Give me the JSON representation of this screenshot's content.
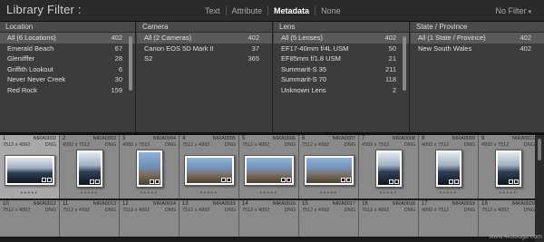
{
  "filter_bar": {
    "title": "Library Filter :",
    "modes": [
      "Text",
      "Attribute",
      "Metadata",
      "None"
    ],
    "active_mode": "Metadata",
    "preset": "No Filter"
  },
  "columns": [
    {
      "header": "Location",
      "rows": [
        {
          "label": "All (6 Locations)",
          "count": "402",
          "selected": true
        },
        {
          "label": "Emerald Beach",
          "count": "67"
        },
        {
          "label": "Glenifffer",
          "count": "28"
        },
        {
          "label": "Griffith Lookout",
          "count": "6"
        },
        {
          "label": "Never Never Creek",
          "count": "30"
        },
        {
          "label": "Red Rock",
          "count": "159"
        }
      ]
    },
    {
      "header": "Camera",
      "rows": [
        {
          "label": "All (2 Cameras)",
          "count": "402",
          "selected": true
        },
        {
          "label": "Canon EOS 5D Mark II",
          "count": "37"
        },
        {
          "label": "S2",
          "count": "365"
        }
      ]
    },
    {
      "header": "Lens",
      "rows": [
        {
          "label": "All (5 Lenses)",
          "count": "402",
          "selected": true
        },
        {
          "label": "EF17-40mm f/4L USM",
          "count": "50"
        },
        {
          "label": "EF85mm f/1.8 USM",
          "count": "21"
        },
        {
          "label": "Summarit-S 35",
          "count": "211"
        },
        {
          "label": "Summarit-S 70",
          "count": "118"
        },
        {
          "label": "Unknown Lens",
          "count": "2"
        }
      ]
    },
    {
      "header": "State / Province",
      "rows": [
        {
          "label": "All (1 State / Province)",
          "count": "402",
          "selected": true
        },
        {
          "label": "New South Wales",
          "count": "402"
        }
      ]
    }
  ],
  "grid": {
    "row1": [
      {
        "index": "1",
        "name": "NIRA0002",
        "dims": "7512 x 4992",
        "format": "DNG",
        "selected": true
      },
      {
        "index": "2",
        "name": "NIRA0003",
        "dims": "4992 x 7512",
        "format": "DNG"
      },
      {
        "index": "3",
        "name": "NIRA0004",
        "dims": "4992 x 7512",
        "format": "DNG"
      },
      {
        "index": "4",
        "name": "NIRA0005",
        "dims": "7512 x 4992",
        "format": "DNG"
      },
      {
        "index": "5",
        "name": "NIRA0006",
        "dims": "7512 x 4992",
        "format": "DNG"
      },
      {
        "index": "6",
        "name": "NIRA0007",
        "dims": "7512 x 4992",
        "format": "DNG"
      },
      {
        "index": "7",
        "name": "NIRA0008",
        "dims": "4992 x 7512",
        "format": "DNG"
      },
      {
        "index": "8",
        "name": "NIRA0009",
        "dims": "4992 x 7512",
        "format": "DNG"
      },
      {
        "index": "9",
        "name": "NIRA0011",
        "dims": "4992 x 7512",
        "format": "DNG"
      }
    ],
    "row2": [
      {
        "index": "10",
        "name": "NIRA0012",
        "dims": "7512 x 4992",
        "format": "DNG"
      },
      {
        "index": "11",
        "name": "NIRA0013",
        "dims": "7512 x 4992",
        "format": "DNG"
      },
      {
        "index": "12",
        "name": "NIRA0014",
        "dims": "7512 x 4992",
        "format": "DNG"
      },
      {
        "index": "13",
        "name": "NIRA0015",
        "dims": "7512 x 4992",
        "format": "DNG"
      },
      {
        "index": "14",
        "name": "NIRA0016",
        "dims": "7512 x 4992",
        "format": "DNG"
      },
      {
        "index": "15",
        "name": "NIRA0017",
        "dims": "7512 x 4992",
        "format": "DNG"
      },
      {
        "index": "16",
        "name": "NIRA0018",
        "dims": "7512 x 4992",
        "format": "DNG"
      },
      {
        "index": "17",
        "name": "NIRA0019",
        "dims": "4992 x 7512",
        "format": "DNG"
      },
      {
        "index": "18",
        "name": "NIRA0020",
        "dims": "7512 x 4992",
        "format": "DNG"
      }
    ]
  },
  "watermark": "www.4kdouga.com"
}
